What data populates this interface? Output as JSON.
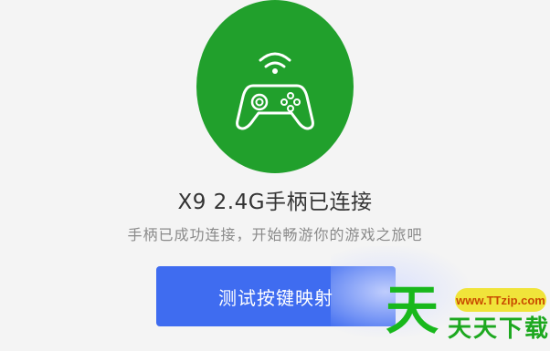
{
  "device": {
    "title": "X9 2.4G手柄已连接",
    "subtitle": "手柄已成功连接，开始畅游你的游戏之旅吧"
  },
  "actions": {
    "test_button_label": "测试按键映射"
  },
  "watermark": {
    "big_char": "天",
    "url": "www.TTzip.com",
    "site_name": "天天下载"
  },
  "icons": {
    "status": "gamepad-wireless-icon"
  },
  "colors": {
    "accent_green": "#21a02c",
    "button_blue": "#3f6cf0",
    "title_text": "#333333",
    "subtitle_text": "#8a8a8a"
  }
}
